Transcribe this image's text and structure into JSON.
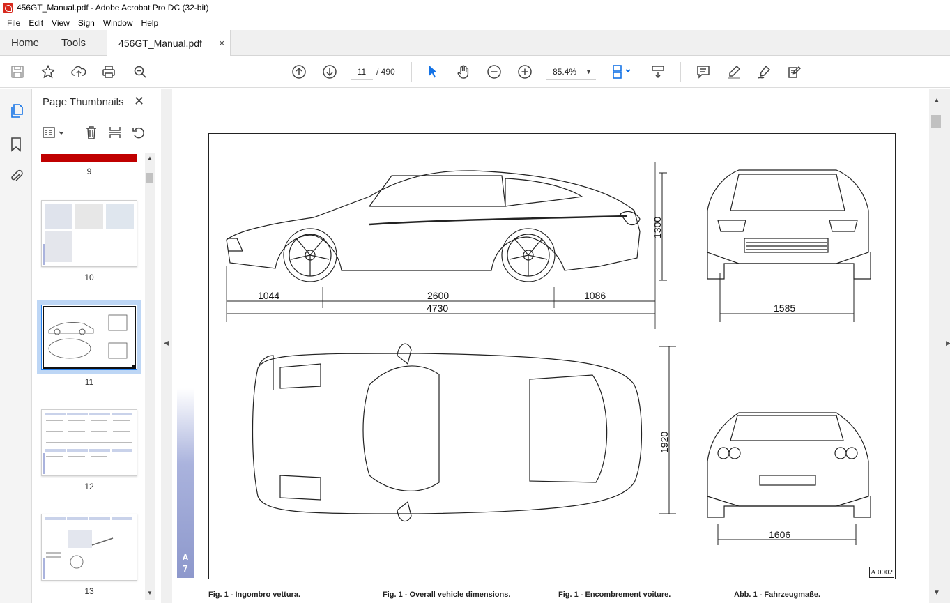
{
  "window": {
    "title": "456GT_Manual.pdf - Adobe Acrobat Pro DC (32-bit)"
  },
  "menu": [
    "File",
    "Edit",
    "View",
    "Sign",
    "Window",
    "Help"
  ],
  "tabs": {
    "home": "Home",
    "tools": "Tools",
    "document": "456GT_Manual.pdf",
    "close_glyph": "×"
  },
  "toolbar": {
    "current_page": "11",
    "page_total": "/ 490",
    "zoom": "85.4%"
  },
  "panel": {
    "title": "Page Thumbnails",
    "close_glyph": "✕",
    "thumbnails": [
      {
        "page": "9"
      },
      {
        "page": "10"
      },
      {
        "page": "11",
        "selected": true
      },
      {
        "page": "12"
      },
      {
        "page": "13"
      }
    ]
  },
  "figure": {
    "side_dims": {
      "height": "1300",
      "front_overhang": "1044",
      "wheelbase": "2600",
      "rear_overhang": "1086",
      "length": "4730"
    },
    "front_track": "1585",
    "width": "1920",
    "rear_track": "1606",
    "section_label": "A\n7",
    "ref_code": "A 0002",
    "captions": [
      "Fig. 1 - Ingombro vettura.",
      "Fig. 1 - Overall vehicle dimensions.",
      "Fig. 1 - Encombrement voiture.",
      "Abb. 1 - Fahrzeugmaße."
    ]
  },
  "colors": {
    "accent": "#2680eb",
    "thumb_select": "#bdd6f5",
    "band": "#8d98cc",
    "red_strip": "#c00000"
  }
}
